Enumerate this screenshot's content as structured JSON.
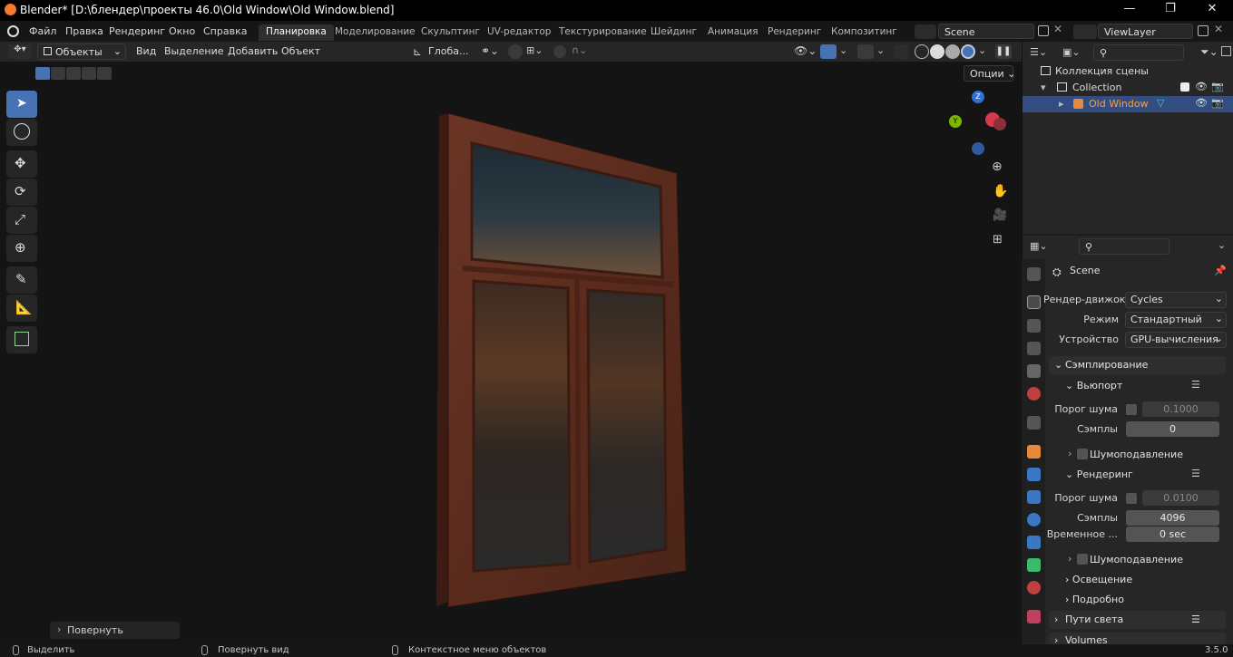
{
  "window": {
    "title": "Blender* [D:\\блендер\\проекты 46.0\\Old Window\\Old Window.blend]",
    "minimize": "—",
    "maximize": "❐",
    "close": "✕"
  },
  "menu": [
    "Файл",
    "Правка",
    "Рендеринг",
    "Окно",
    "Справка"
  ],
  "workspaces": [
    "Планировка",
    "Моделирование",
    "Скульптинг",
    "UV-редактор",
    "Текстурирование",
    "Шейдинг",
    "Анимация",
    "Рендеринг",
    "Композитинг"
  ],
  "active_workspace": 0,
  "scene_field": "Scene",
  "view_layer_field": "ViewLayer",
  "viewport_header": {
    "mode": "Объекты",
    "view": "Вид",
    "select": "Выделение",
    "add": "Добавить",
    "object": "Объект",
    "transform": "Глоба...",
    "options": "Опции"
  },
  "operator_panel": "Повернуть",
  "outliner": {
    "scene_collection": "Коллекция сцены",
    "collection": "Collection",
    "object": "Old Window"
  },
  "properties": {
    "scene_name": "Scene",
    "render_engine_label": "Рендер-движок",
    "render_engine": "Cycles",
    "mode_label": "Режим",
    "mode": "Стандартный",
    "device_label": "Устройство",
    "device": "GPU-вычисления",
    "sampling": "Сэмплирование",
    "viewport": "Вьюпорт",
    "noise_threshold_label": "Порог шума",
    "viewport_noise_threshold": "0.1000",
    "samples_label": "Сэмплы",
    "viewport_samples": "0",
    "denoise": "Шумоподавление",
    "render": "Рендеринг",
    "render_noise_threshold": "0.0100",
    "render_samples": "4096",
    "time_limit_label": "Временное ...",
    "time_limit": "0 sec",
    "render_denoise": "Шумоподавление",
    "lights": "Освещение",
    "advanced": "Подробно",
    "light_paths": "Пути света",
    "volumes": "Volumes"
  },
  "statusbar": {
    "select": "Выделить",
    "rotate_view": "Повернуть вид",
    "context_menu": "Контекстное меню объектов",
    "version": "3.5.0"
  },
  "colors": {
    "accent": "#4772b3",
    "selected_row": "#334d80",
    "object_orange": "#f0a34a"
  }
}
